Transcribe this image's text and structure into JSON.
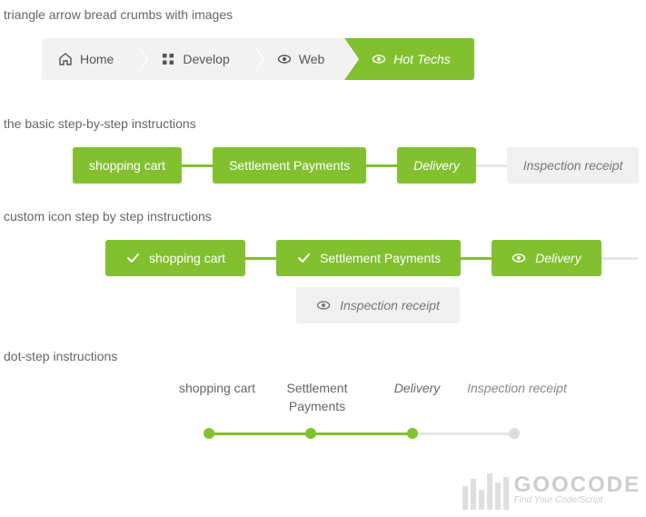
{
  "colors": {
    "accent": "#82c02f",
    "muted_bg": "#f0f0f0",
    "text": "#666666"
  },
  "sections": {
    "breadcrumb": {
      "title": "triangle arrow bread crumbs with images",
      "items": [
        {
          "label": "Home",
          "icon": "home-icon",
          "active": false
        },
        {
          "label": "Develop",
          "icon": "grid-icon",
          "active": false
        },
        {
          "label": "Web",
          "icon": "eye-icon",
          "active": false
        },
        {
          "label": "Hot Techs",
          "icon": "eye-icon",
          "active": true
        }
      ]
    },
    "basic_steps": {
      "title": "the basic step-by-step instructions",
      "items": [
        {
          "label": "shopping cart",
          "state": "done"
        },
        {
          "label": "Settlement Payments",
          "state": "done"
        },
        {
          "label": "Delivery",
          "state": "current"
        },
        {
          "label": "Inspection receipt",
          "state": "future"
        }
      ]
    },
    "icon_steps": {
      "title": "custom icon step by step instructions",
      "items": [
        {
          "label": "shopping cart",
          "icon": "check-icon",
          "state": "done"
        },
        {
          "label": "Settlement Payments",
          "icon": "check-icon",
          "state": "done"
        },
        {
          "label": "Delivery",
          "icon": "eye-icon",
          "state": "current"
        },
        {
          "label": "Inspection receipt",
          "icon": "eye-icon",
          "state": "future"
        }
      ]
    },
    "dot_steps": {
      "title": "dot-step instructions",
      "items": [
        {
          "label": "shopping cart",
          "state": "done"
        },
        {
          "label": "Settlement Payments",
          "state": "done"
        },
        {
          "label": "Delivery",
          "state": "current"
        },
        {
          "label": "Inspection receipt",
          "state": "future"
        }
      ]
    }
  },
  "watermark": {
    "brand": "GOOCODE",
    "tagline": "Find Your Code/Script"
  }
}
